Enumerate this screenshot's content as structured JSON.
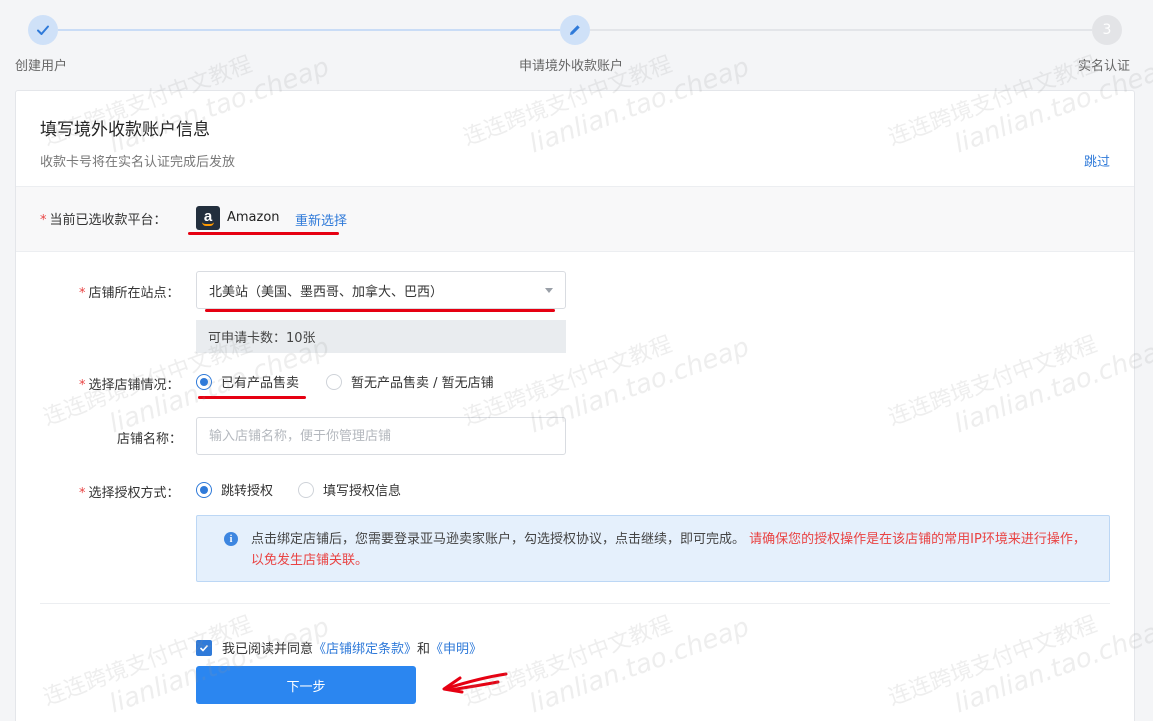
{
  "steps": [
    {
      "label": "创建用户",
      "state": "done"
    },
    {
      "label": "申请境外收款账户",
      "state": "active"
    },
    {
      "label": "实名认证",
      "state": "todo",
      "number": "3"
    }
  ],
  "card": {
    "title": "填写境外收款账户信息",
    "subtitle": "收款卡号将在实名认证完成后发放",
    "skip_label": "跳过"
  },
  "platform": {
    "label": "当前已选收款平台：",
    "name": "Amazon",
    "logo_letter": "a",
    "reselect_label": "重新选择"
  },
  "site": {
    "label": "店铺所在站点：",
    "selected": "北美站（美国、墨西哥、加拿大、巴西）",
    "quota_text": "可申请卡数：10张"
  },
  "store_status": {
    "label": "选择店铺情况：",
    "options": [
      {
        "label": "已有产品售卖",
        "checked": true
      },
      {
        "label": "暂无产品售卖 / 暂无店铺",
        "checked": false
      }
    ]
  },
  "store_name": {
    "label": "店铺名称：",
    "placeholder": "输入店铺名称，便于你管理店铺",
    "value": ""
  },
  "auth_method": {
    "label": "选择授权方式：",
    "options": [
      {
        "label": "跳转授权",
        "checked": true
      },
      {
        "label": "填写授权信息",
        "checked": false
      }
    ]
  },
  "notice": {
    "text": "点击绑定店铺后，您需要登录亚马逊卖家账户，勾选授权协议，点击继续，即可完成。",
    "warning": "请确保您的授权操作是在该店铺的常用IP环境来进行操作，以免发生店铺关联。"
  },
  "agreement": {
    "prefix": "我已阅读并同意",
    "terms_link": "《店铺绑定条款》",
    "conjunction": "和",
    "statement_link": "《申明》",
    "checked": true
  },
  "next_button": "下一步",
  "watermark": {
    "cn": "连连跨境支付中文教程",
    "en": "lianlian.tao.cheap"
  },
  "colors": {
    "primary": "#2f7ad9",
    "button": "#2b86f0",
    "required": "#e94343",
    "annotation": "#e60012"
  }
}
